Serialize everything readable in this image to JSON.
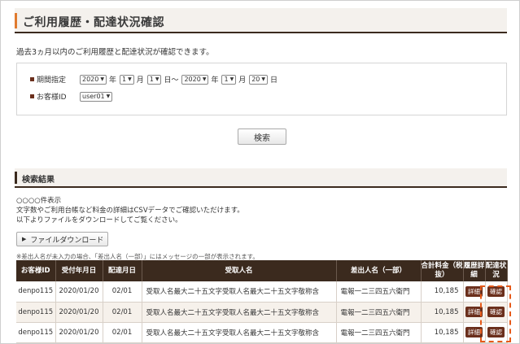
{
  "page_title": "ご利用履歴・配達状況確認",
  "description": "過去3ヵ月以内のご利用履歴と配達状況が確認できます。",
  "filter": {
    "period_label": "期間指定",
    "from_year": "2020",
    "from_month": "1",
    "from_day": "1",
    "to_year": "2020",
    "to_month": "1",
    "to_day": "20",
    "unit_year": "年",
    "unit_month": "月",
    "unit_day_from": "日～",
    "unit_day_to": "日",
    "customer_label": "お客様ID",
    "customer_value": "user01"
  },
  "search_label": "検索",
  "results": {
    "heading": "検索結果",
    "count_text": "○○○○件表示",
    "info_line1": "文字数やご利用台帳など料金の詳細はCSVデータでご確認いただけます。",
    "info_line2": "以下よりファイルをダウンロードしてご覧ください。",
    "download_label": "ファイルダウンロード",
    "note": "※差出人名が未入力の場合、「差出人名（一部）」にはメッセージの一部が表示されます。",
    "columns": [
      "お客様ID",
      "受付年月日",
      "配達月日",
      "受取人名",
      "差出人名（一部）",
      "合計料金（税抜）",
      "履歴詳細",
      "配達状況"
    ],
    "rows": [
      {
        "id": "denpo115",
        "date": "2020/01/20",
        "delivery": "02/01",
        "recipient": "受取人名最大二十五文字受取人名最大二十五文字敬称含",
        "sender": "電報一二三四五六衛門",
        "total": "10,185",
        "detail": "詳細",
        "status": "確認"
      },
      {
        "id": "denpo115",
        "date": "2020/01/20",
        "delivery": "02/01",
        "recipient": "受取人名最大二十五文字受取人名最大二十五文字敬称含",
        "sender": "電報一二三四五六衛門",
        "total": "10,185",
        "detail": "詳細",
        "status": "確認"
      },
      {
        "id": "denpo115",
        "date": "2020/01/20",
        "delivery": "02/01",
        "recipient": "受取人名最大二十五文字受取人名最大二十五文字敬称含",
        "sender": "電報一二三四五六衛門",
        "total": "10,185",
        "detail": "詳細",
        "status": "確認"
      }
    ]
  },
  "colors": {
    "accent": "#e07a2e",
    "header_dark": "#3b2a1e",
    "button_dark": "#6b2f1c",
    "highlight": "#e65a1a"
  }
}
